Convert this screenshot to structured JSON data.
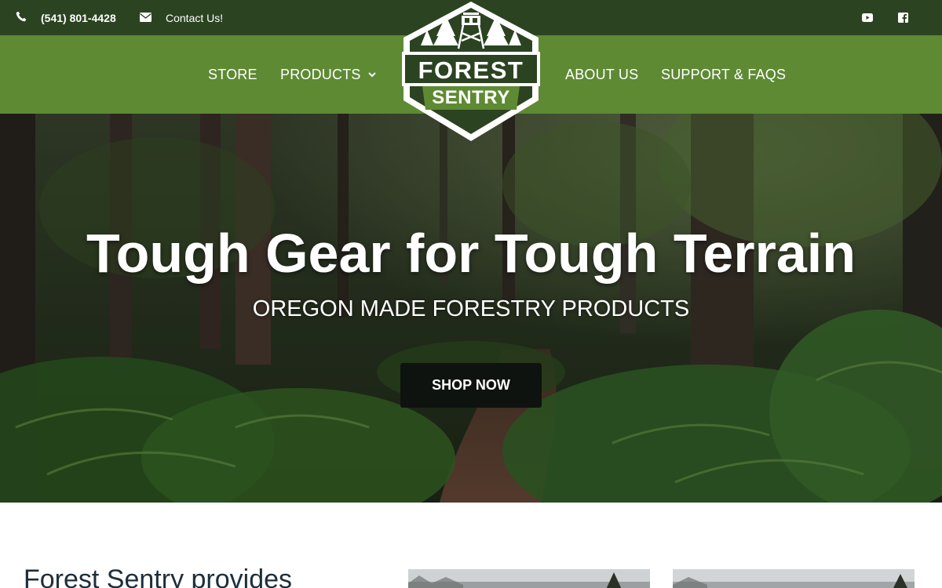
{
  "topbar": {
    "phone": "(541) 801-4428",
    "contact": "Contact Us!",
    "icons": [
      "phone-icon",
      "envelope-icon",
      "youtube-icon",
      "facebook-icon"
    ],
    "background": "#2c4322"
  },
  "nav": {
    "items": [
      {
        "label": "STORE"
      },
      {
        "label": "PRODUCTS"
      },
      {
        "label": "ABOUT US"
      },
      {
        "label": "SUPPORT & FAQS"
      }
    ],
    "background": "#5e8a33"
  },
  "logo": {
    "line1": "FOREST",
    "line2": "SENTRY"
  },
  "hero": {
    "title": "Tough Gear for Tough Terrain",
    "subtitle": "OREGON MADE FORESTRY PRODUCTS",
    "button": "SHOP NOW"
  },
  "intro": {
    "heading": "Forest Sentry provides"
  }
}
